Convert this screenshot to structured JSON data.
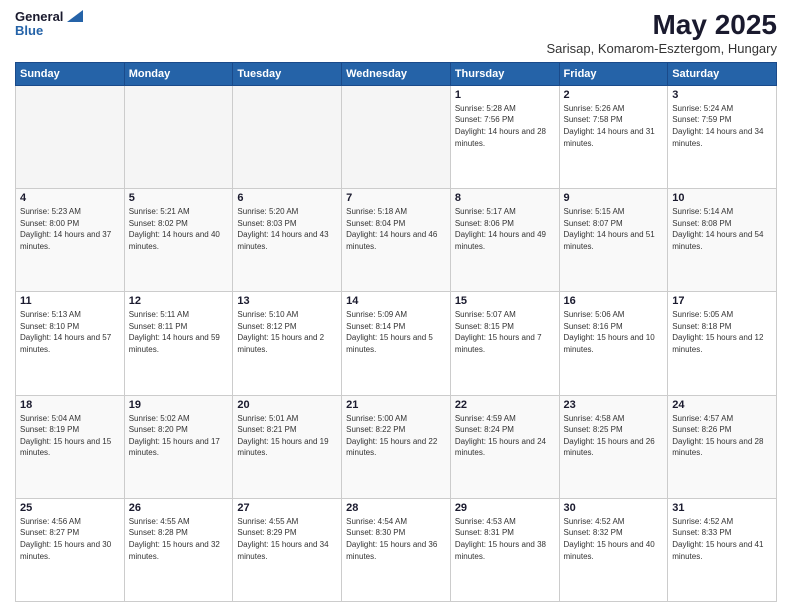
{
  "header": {
    "logo_line1": "General",
    "logo_line2": "Blue",
    "month": "May 2025",
    "location": "Sarisap, Komarom-Esztergom, Hungary"
  },
  "days_of_week": [
    "Sunday",
    "Monday",
    "Tuesday",
    "Wednesday",
    "Thursday",
    "Friday",
    "Saturday"
  ],
  "weeks": [
    [
      {
        "day": "",
        "empty": true
      },
      {
        "day": "",
        "empty": true
      },
      {
        "day": "",
        "empty": true
      },
      {
        "day": "",
        "empty": true
      },
      {
        "day": "1",
        "sunrise": "5:28 AM",
        "sunset": "7:56 PM",
        "daylight": "14 hours and 28 minutes."
      },
      {
        "day": "2",
        "sunrise": "5:26 AM",
        "sunset": "7:58 PM",
        "daylight": "14 hours and 31 minutes."
      },
      {
        "day": "3",
        "sunrise": "5:24 AM",
        "sunset": "7:59 PM",
        "daylight": "14 hours and 34 minutes."
      }
    ],
    [
      {
        "day": "4",
        "sunrise": "5:23 AM",
        "sunset": "8:00 PM",
        "daylight": "14 hours and 37 minutes."
      },
      {
        "day": "5",
        "sunrise": "5:21 AM",
        "sunset": "8:02 PM",
        "daylight": "14 hours and 40 minutes."
      },
      {
        "day": "6",
        "sunrise": "5:20 AM",
        "sunset": "8:03 PM",
        "daylight": "14 hours and 43 minutes."
      },
      {
        "day": "7",
        "sunrise": "5:18 AM",
        "sunset": "8:04 PM",
        "daylight": "14 hours and 46 minutes."
      },
      {
        "day": "8",
        "sunrise": "5:17 AM",
        "sunset": "8:06 PM",
        "daylight": "14 hours and 49 minutes."
      },
      {
        "day": "9",
        "sunrise": "5:15 AM",
        "sunset": "8:07 PM",
        "daylight": "14 hours and 51 minutes."
      },
      {
        "day": "10",
        "sunrise": "5:14 AM",
        "sunset": "8:08 PM",
        "daylight": "14 hours and 54 minutes."
      }
    ],
    [
      {
        "day": "11",
        "sunrise": "5:13 AM",
        "sunset": "8:10 PM",
        "daylight": "14 hours and 57 minutes."
      },
      {
        "day": "12",
        "sunrise": "5:11 AM",
        "sunset": "8:11 PM",
        "daylight": "14 hours and 59 minutes."
      },
      {
        "day": "13",
        "sunrise": "5:10 AM",
        "sunset": "8:12 PM",
        "daylight": "15 hours and 2 minutes."
      },
      {
        "day": "14",
        "sunrise": "5:09 AM",
        "sunset": "8:14 PM",
        "daylight": "15 hours and 5 minutes."
      },
      {
        "day": "15",
        "sunrise": "5:07 AM",
        "sunset": "8:15 PM",
        "daylight": "15 hours and 7 minutes."
      },
      {
        "day": "16",
        "sunrise": "5:06 AM",
        "sunset": "8:16 PM",
        "daylight": "15 hours and 10 minutes."
      },
      {
        "day": "17",
        "sunrise": "5:05 AM",
        "sunset": "8:18 PM",
        "daylight": "15 hours and 12 minutes."
      }
    ],
    [
      {
        "day": "18",
        "sunrise": "5:04 AM",
        "sunset": "8:19 PM",
        "daylight": "15 hours and 15 minutes."
      },
      {
        "day": "19",
        "sunrise": "5:02 AM",
        "sunset": "8:20 PM",
        "daylight": "15 hours and 17 minutes."
      },
      {
        "day": "20",
        "sunrise": "5:01 AM",
        "sunset": "8:21 PM",
        "daylight": "15 hours and 19 minutes."
      },
      {
        "day": "21",
        "sunrise": "5:00 AM",
        "sunset": "8:22 PM",
        "daylight": "15 hours and 22 minutes."
      },
      {
        "day": "22",
        "sunrise": "4:59 AM",
        "sunset": "8:24 PM",
        "daylight": "15 hours and 24 minutes."
      },
      {
        "day": "23",
        "sunrise": "4:58 AM",
        "sunset": "8:25 PM",
        "daylight": "15 hours and 26 minutes."
      },
      {
        "day": "24",
        "sunrise": "4:57 AM",
        "sunset": "8:26 PM",
        "daylight": "15 hours and 28 minutes."
      }
    ],
    [
      {
        "day": "25",
        "sunrise": "4:56 AM",
        "sunset": "8:27 PM",
        "daylight": "15 hours and 30 minutes."
      },
      {
        "day": "26",
        "sunrise": "4:55 AM",
        "sunset": "8:28 PM",
        "daylight": "15 hours and 32 minutes."
      },
      {
        "day": "27",
        "sunrise": "4:55 AM",
        "sunset": "8:29 PM",
        "daylight": "15 hours and 34 minutes."
      },
      {
        "day": "28",
        "sunrise": "4:54 AM",
        "sunset": "8:30 PM",
        "daylight": "15 hours and 36 minutes."
      },
      {
        "day": "29",
        "sunrise": "4:53 AM",
        "sunset": "8:31 PM",
        "daylight": "15 hours and 38 minutes."
      },
      {
        "day": "30",
        "sunrise": "4:52 AM",
        "sunset": "8:32 PM",
        "daylight": "15 hours and 40 minutes."
      },
      {
        "day": "31",
        "sunrise": "4:52 AM",
        "sunset": "8:33 PM",
        "daylight": "15 hours and 41 minutes."
      }
    ]
  ]
}
